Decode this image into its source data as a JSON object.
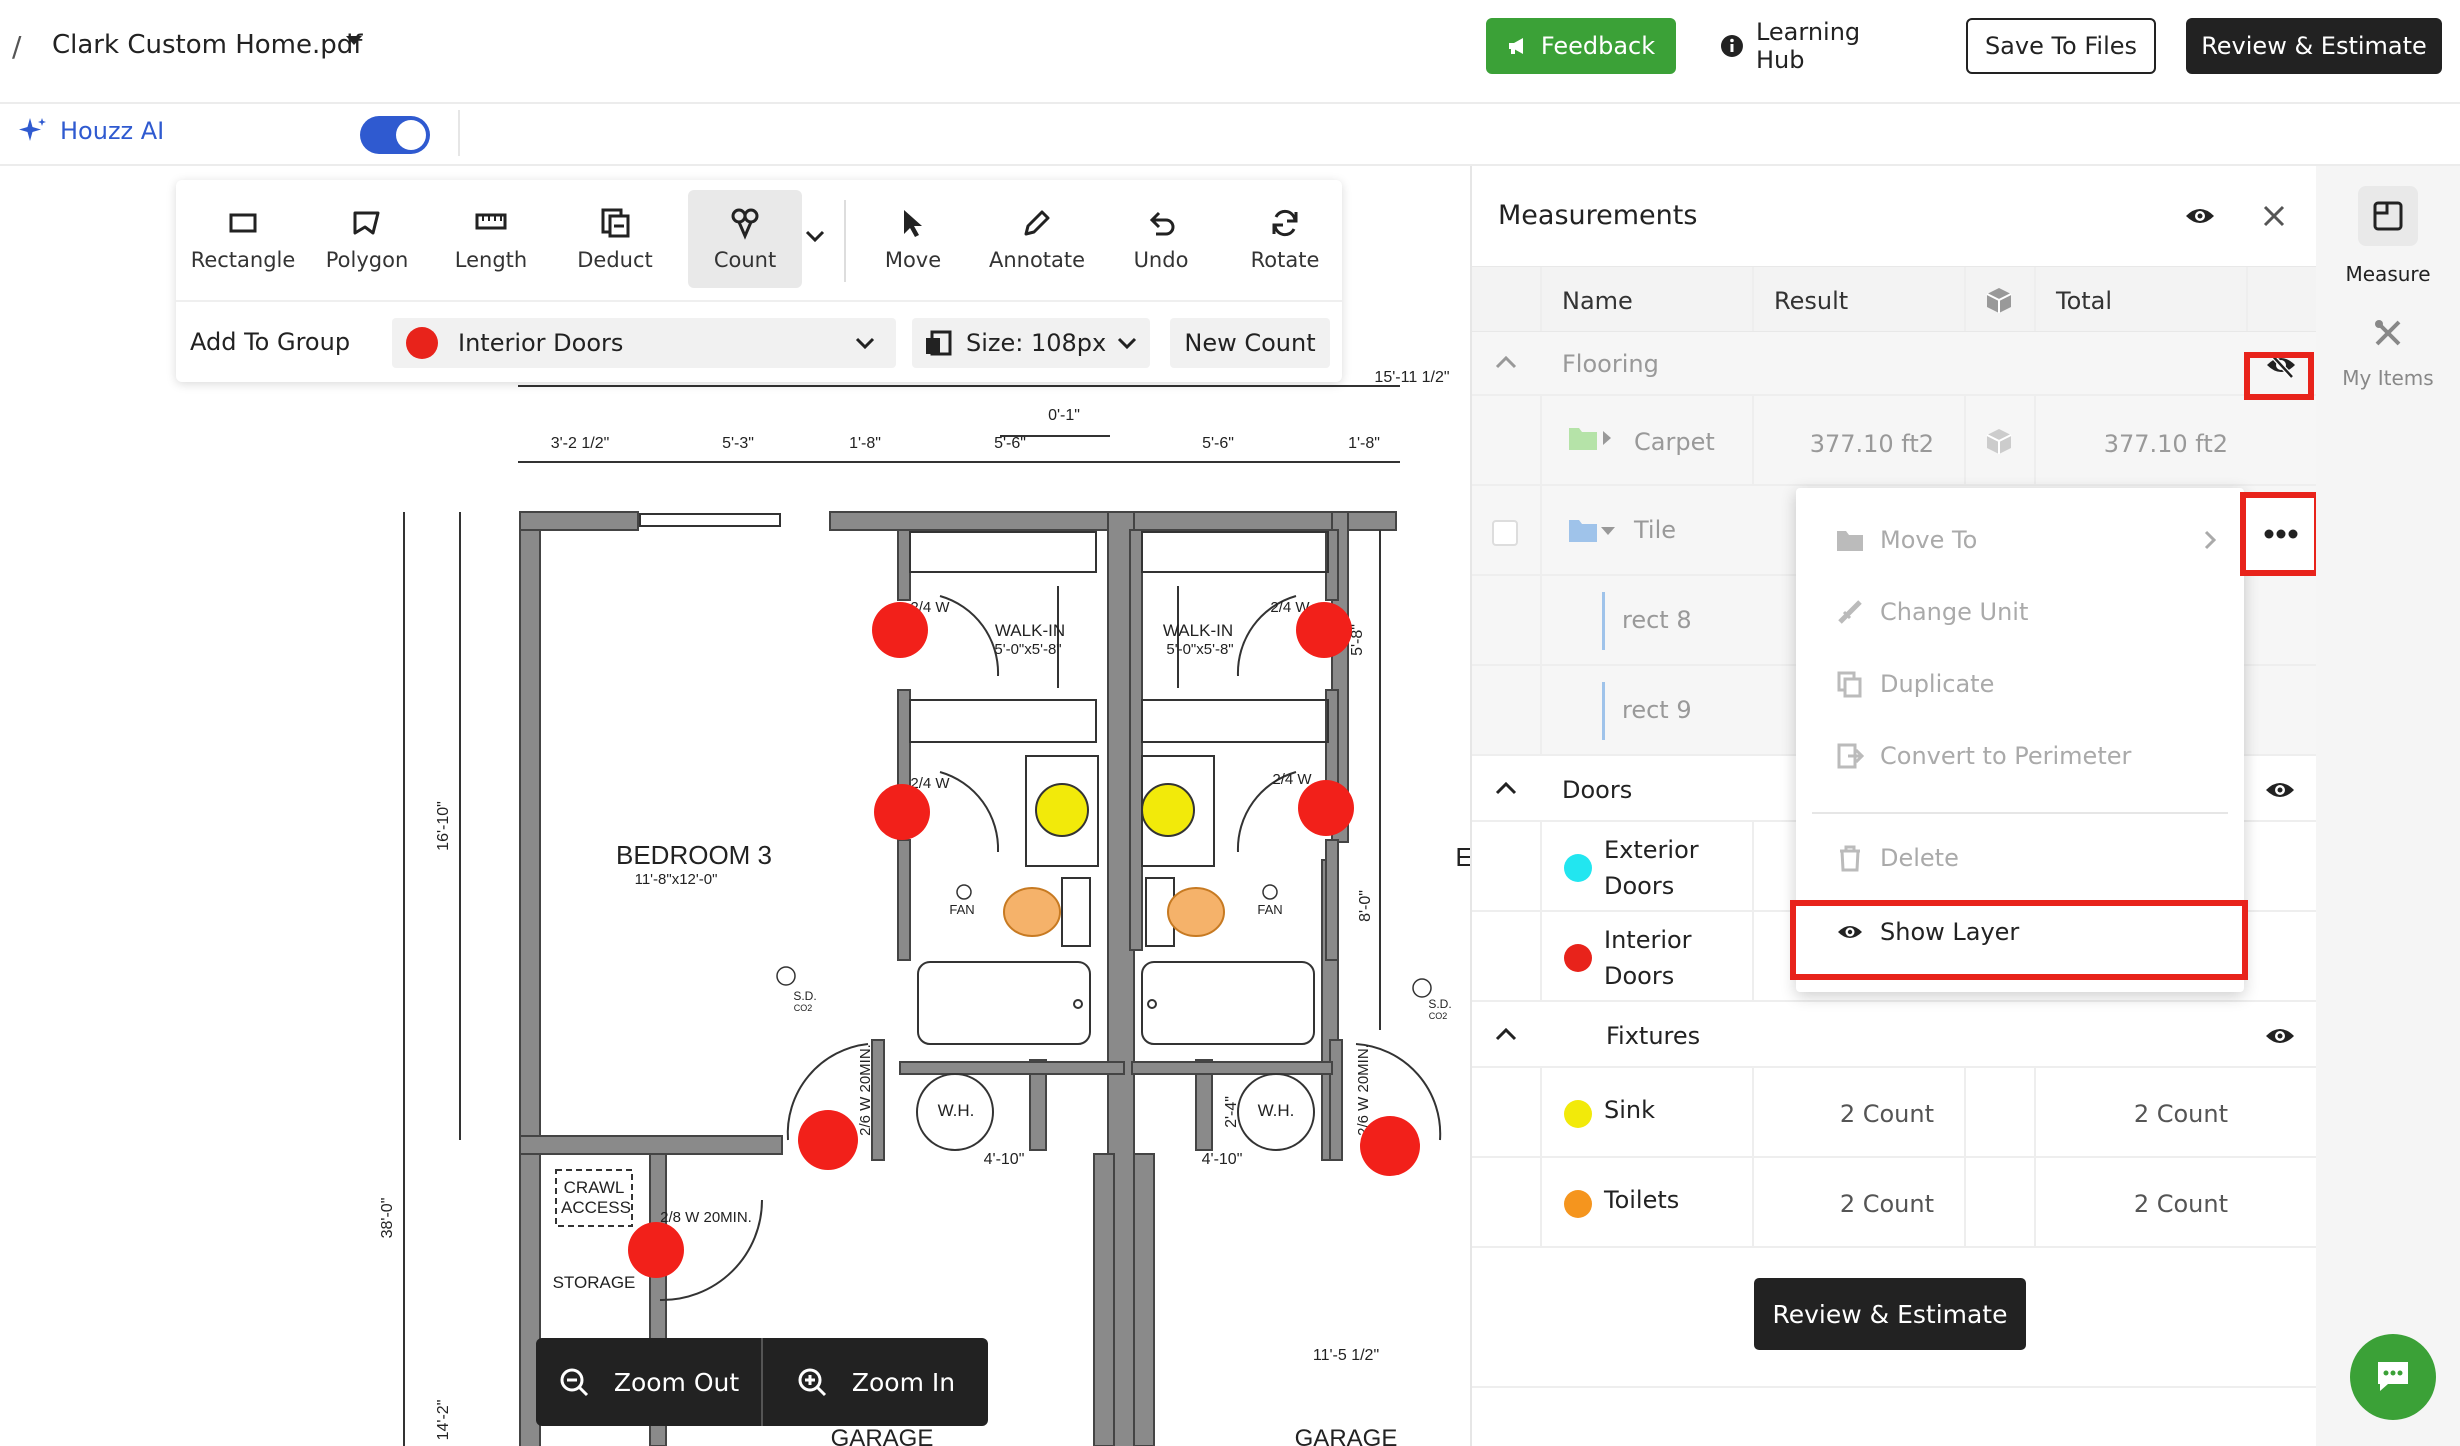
{
  "header": {
    "breadcrumb_sep": "/",
    "file_name": "Clark Custom Home.pdf",
    "feedback": "Feedback",
    "learning_hub": "Learning Hub",
    "save_to_files": "Save To Files",
    "review_estimate": "Review & Estimate"
  },
  "subbar": {
    "houzz_ai": "Houzz AI",
    "toggle_on": true
  },
  "toolbar": {
    "tools": [
      "Rectangle",
      "Polygon",
      "Length",
      "Deduct",
      "Count",
      "Move",
      "Annotate",
      "Undo",
      "Rotate"
    ],
    "active_tool": "Count",
    "add_to_group": "Add To Group",
    "group": "Interior Doors",
    "group_color": "#e8231b",
    "size": "Size: 108px",
    "new_count": "New Count"
  },
  "panel": {
    "title": "Measurements",
    "columns": {
      "name": "Name",
      "result": "Result",
      "total": "Total"
    },
    "flooring": {
      "label": "Flooring"
    },
    "carpet": {
      "name": "Carpet",
      "result": "377.10 ft2",
      "total": "377.10 ft2"
    },
    "tile": {
      "name": "Tile"
    },
    "rect8": "rect 8",
    "rect9": "rect 9",
    "doors": {
      "label": "Doors"
    },
    "exterior": {
      "name1": "Exterior",
      "name2": "Doors",
      "color": "#22e6f0"
    },
    "interior": {
      "name1": "Interior",
      "name2": "Doors",
      "color": "#e8231b"
    },
    "fixtures": {
      "label": "Fixtures"
    },
    "sink": {
      "name": "Sink",
      "result": "2 Count",
      "total": "2 Count",
      "color": "#f2ea0a"
    },
    "toilets": {
      "name": "Toilets",
      "result": "2 Count",
      "total": "2 Count",
      "color": "#f5951e"
    },
    "review_estimate": "Review & Estimate"
  },
  "context_menu": {
    "move_to": "Move To",
    "change_unit": "Change Unit",
    "duplicate": "Duplicate",
    "convert": "Convert to Perimeter",
    "delete": "Delete",
    "show_layer": "Show Layer"
  },
  "right_rail": {
    "measure": "Measure",
    "my_items": "My Items"
  },
  "zoom": {
    "out": "Zoom Out",
    "in": "Zoom In"
  },
  "plan": {
    "bedroom": "BEDROOM 3",
    "bedroom_dim": "11'-8\"x12'-0\"",
    "walkin": "WALK-IN",
    "walkin_dim": "5'-0\"x5'-8\"",
    "fan": "FAN",
    "wh": "W.H.",
    "crawl": "CRAWL",
    "access": "ACCESS",
    "storage": "STORAGE",
    "garage": "GARAGE",
    "sd": "S.D.",
    "co2": "CO2",
    "d_3_2": "3'-2 1/2\"",
    "d_5_3": "5'-3\"",
    "d_1_8": "1'-8\"",
    "d_5_6": "5'-6\"",
    "d_0_1": "0'-1\"",
    "d_15_11": "15'-11 1/2\"",
    "d_16_10": "16'-10\"",
    "d_38_0": "38'-0\"",
    "d_14_2": "14'-2\"",
    "d_4_10": "4'-10\"",
    "d_11_5": "11'-5 1/2\"",
    "d_8_0": "8'-0\"",
    "d_5_8": "5'-8\"",
    "d_2_4": "2'-4\"",
    "d_24w": "2/4 W",
    "d_26w": "2/6 W 20MIN.",
    "d_28w": "2/8 W 20MIN.",
    "e_letter": "E"
  }
}
